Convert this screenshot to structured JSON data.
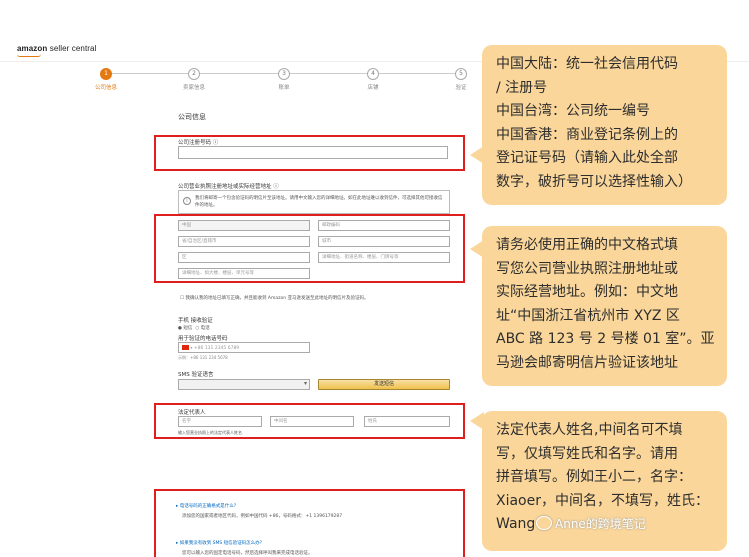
{
  "header": {
    "logo_amazon": "amazon",
    "logo_rest": " seller central"
  },
  "steps": [
    {
      "num": "1",
      "label": "公司信息"
    },
    {
      "num": "2",
      "label": "卖家信息"
    },
    {
      "num": "3",
      "label": "账单"
    },
    {
      "num": "4",
      "label": "店铺"
    },
    {
      "num": "5",
      "label": "验证"
    }
  ],
  "form": {
    "section_title": "公司信息",
    "reg_no_label": "公司注册号码 ⓘ",
    "address_label": "公司营业执照注册地址或实际经营地址 ⓘ",
    "address_info": "我们将邮寄一个包含验证码的明信片至该地址。请用中文输入您的详细地址。如在此地址难以收到信件，可选择其他可接收信件的地址。",
    "address_fields": {
      "country": "中国",
      "postcode": "邮政编码",
      "province": "省/自治区/直辖市",
      "city": "城市",
      "district": "区",
      "street": "详细地址、街道名称、楼层、门牌号等",
      "building": "详细地址、如大楼、楼层、单元号等"
    },
    "confirm_text": "我确认我的地址已填写正确，并且能收到 Amazon 亚马逊发送至此地址的明信片及验证码。",
    "contact_method_label": "手机 接收验证",
    "radio_sms": "短信",
    "radio_call": "电话",
    "phone_label": "用于验证的电话号码",
    "phone_placeholder": "+86 131 2345 6789",
    "phone_example": "示例：+86 131 234 5678",
    "sms_language_label": "SMS 验证语言",
    "send_sms_button": "发送短信",
    "legal_rep_label": "法定代表人",
    "first_name": "名字",
    "middle_name": "中间名",
    "last_name": "姓氏",
    "legal_rep_hint": "输入您营业执照上的法定代表人姓名",
    "faq_1_q": "▸ 电话号码的正确格式是什么？",
    "faq_1_a": "添加您的国家或者地区代码，例如中国代码 +86，号码格式：+1 1396179287",
    "faq_2_q": "▸ 如果我没有收到 SMS 短信验证码怎么办？",
    "faq_2_a": "您可以输入您的固定电话号码，然后选择呼叫我来完成电话验证。"
  },
  "callouts": {
    "c1": [
      "中国大陆：统一社会信用代码",
      "/ 注册号",
      "中国台湾：公司统一编号",
      "中国香港：商业登记条例上的",
      "登记证号码（请输入此处全部",
      "数字，破折号可以选择性输入）"
    ],
    "c2": [
      "请务必使用正确的中文格式填",
      "写您公司营业执照注册地址或",
      "实际经营地址。例如：中文地",
      "址“中国浙江省杭州市 XYZ 区",
      "ABC 路 123 号 2 号楼 01 室”。亚",
      "马逊会邮寄明信片验证该地址"
    ],
    "c3": [
      "法定代表人姓名,中间名可不填",
      "写，仅填写姓氏和名字。请用",
      "拼音填写。例如王小二，名字：",
      "Xiaoer，中间名，不填写，姓氏：",
      "Wang"
    ]
  },
  "watermark": "Anne的跨境笔记",
  "colors": {
    "accent": "#e47911",
    "highlight": "#e01e1e",
    "callout_bg": "#fad69a"
  }
}
